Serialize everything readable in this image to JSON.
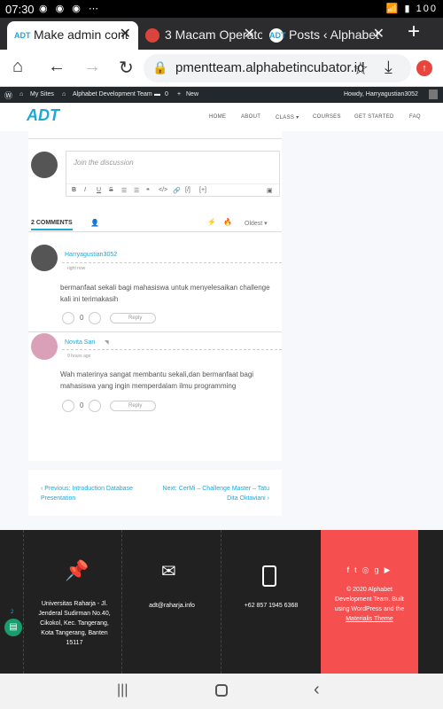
{
  "status_bar": {
    "time": "07:30",
    "icons_left": "◉ ◉ ◉ ⋯",
    "icons_right": "📶 ▮ 100"
  },
  "tabs": [
    {
      "label": "Make admin cont",
      "active": true,
      "favicon": "adt-logo-icon"
    },
    {
      "label": "3 Macam Operato",
      "active": false,
      "favicon": "operator-icon"
    },
    {
      "label": "Posts ‹ Alphabet",
      "active": false,
      "favicon": "adt-logo-icon"
    }
  ],
  "new_tab_label": "+",
  "address_bar": {
    "url": "pmentteam.alphabetincubator.id"
  },
  "wp_admin_bar": {
    "my_sites": "My Sites",
    "site_name": "Alphabet Development Team",
    "comments_count": "0",
    "new_label": "New",
    "howdy": "Howdy, Harryagustian3052"
  },
  "site": {
    "logo_text": "ADT",
    "menu": [
      "HOME",
      "ABOUT",
      "CLASS ▾",
      "COURSES",
      "GET STARTED",
      "FAQ"
    ]
  },
  "discussion": {
    "placeholder": "Join the discussion",
    "toolbar": [
      "B",
      "I",
      "U",
      "S",
      "☰",
      "☰",
      "❝",
      "</>",
      "🔗",
      "[/]",
      "[+]"
    ],
    "comments_tab": "2 COMMENTS",
    "sort_label": "Oldest ▾"
  },
  "comments": [
    {
      "author": "Harryagustian3052",
      "time": "right now",
      "text": "bermanfaat sekali bagi mahasiswa untuk menyelesaikan challenge kali ini terimakasih",
      "votes": "0",
      "reply_label": "Reply"
    },
    {
      "author": "Novita Sari",
      "time": "9 hours ago",
      "text": "Wah materinya sangat membantu sekali,dan bermanfaat bagi mahasiswa yang ingin memperdalam ilmu programming",
      "votes": "0",
      "reply_label": "Reply"
    }
  ],
  "post_nav": {
    "prev": "‹  Previous: Introduction Database Presentation",
    "next": "Next: CerMi – Challenge Master – Tatu Dita Oktaviani  ›"
  },
  "footer": {
    "address": "Universitas Raharja - Jl. Jenderal Sudirman No.40, Cikokol, Kec. Tangerang, Kota Tangerang, Banten 15117",
    "email": "adt@raharja.info",
    "phone": "+62 857 1945 6368",
    "copyright": "© 2020 Alphabet Development Team. Built using WordPress and the",
    "theme_link": "Materialis Theme",
    "social_icons": [
      "facebook-icon",
      "twitter-icon",
      "instagram-icon",
      "google-plus-icon",
      "youtube-icon"
    ]
  },
  "chat_badge": "2",
  "colors": {
    "accent": "#1fa7d8",
    "footer_red": "#f54f4f",
    "footer_bg": "#212121"
  }
}
